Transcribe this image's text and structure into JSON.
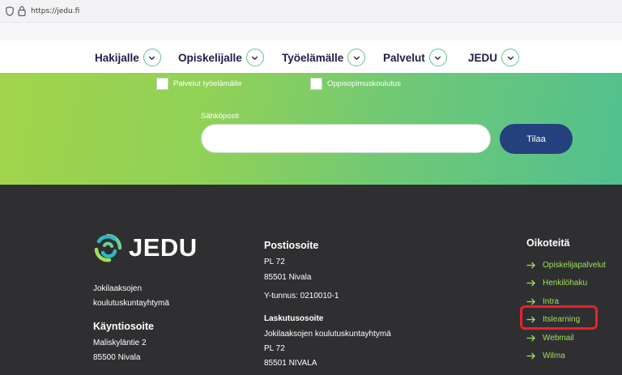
{
  "browser": {
    "url": "https://jedu.fi"
  },
  "nav": {
    "items": [
      {
        "label": "Hakijalle"
      },
      {
        "label": "Opiskelijalle"
      },
      {
        "label": "Työelämälle"
      },
      {
        "label": "Palvelut"
      },
      {
        "label": "JEDU"
      }
    ]
  },
  "subscribe": {
    "checkboxes": [
      {
        "label": "Palvelut työelämälle",
        "checked": false
      },
      {
        "label": "Oppisopimuskoulutus",
        "checked": false
      }
    ],
    "email_label": "Sähköposti",
    "email_value": "",
    "button_label": "Tilaa"
  },
  "footer": {
    "logo_text": "JEDU",
    "org_lines": [
      "Jokilaaksojen",
      "koulutuskuntayhtymä"
    ],
    "visit": {
      "heading": "Käyntiosoite",
      "lines": [
        "Maliskyläntie 2",
        "85500 Nivala"
      ]
    },
    "postal": {
      "heading": "Postiosoite",
      "lines": [
        "PL 72",
        "85501 Nivala"
      ]
    },
    "business_id": "Y-tunnus: 0210010-1",
    "invoicing": {
      "heading": "Laskutusosoite",
      "lines": [
        "Jokilaaksojen koulutuskuntayhtymä",
        "PL 72",
        "85501 NIVALA"
      ]
    },
    "shortcuts": {
      "heading": "Oikoteitä",
      "links": [
        {
          "label": "Opiskelijapalvelut"
        },
        {
          "label": "Henkilöhaku"
        },
        {
          "label": "Intra"
        },
        {
          "label": "Itslearning",
          "highlighted": true
        },
        {
          "label": "Webmail"
        },
        {
          "label": "Wilma"
        }
      ]
    }
  },
  "colors": {
    "accent_green": "#9fe05a",
    "nav_text": "#1e1e46",
    "button_blue": "#24407d",
    "footer_bg": "#2f2f32",
    "highlight_red": "#e8232b"
  }
}
